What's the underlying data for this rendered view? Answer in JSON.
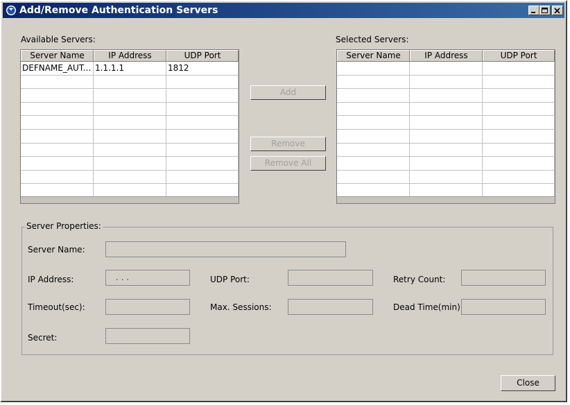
{
  "window": {
    "title": "Add/Remove Authentication Servers"
  },
  "available": {
    "label": "Available Servers:",
    "columns": [
      "Server Name",
      "IP Address",
      "UDP Port"
    ],
    "rows": [
      [
        "DEFNAME_AUT...",
        "1.1.1.1",
        "1812"
      ]
    ]
  },
  "selected": {
    "label": "Selected Servers:",
    "columns": [
      "Server Name",
      "IP Address",
      "UDP Port"
    ],
    "rows": []
  },
  "buttons": {
    "add": "Add",
    "remove": "Remove",
    "remove_all": "Remove All",
    "close": "Close"
  },
  "properties": {
    "group_title": "Server Properties:",
    "server_name_label": "Server Name:",
    "server_name_value": "",
    "ip_address_label": "IP Address:",
    "ip_address_value": ".   .   .",
    "udp_port_label": "UDP Port:",
    "udp_port_value": "",
    "retry_count_label": "Retry Count:",
    "retry_count_value": "",
    "timeout_label": "Timeout(sec):",
    "timeout_value": "",
    "max_sessions_label": "Max. Sessions:",
    "max_sessions_value": "",
    "dead_time_label": "Dead Time(min):",
    "dead_time_value": "",
    "secret_label": "Secret:",
    "secret_value": ""
  }
}
